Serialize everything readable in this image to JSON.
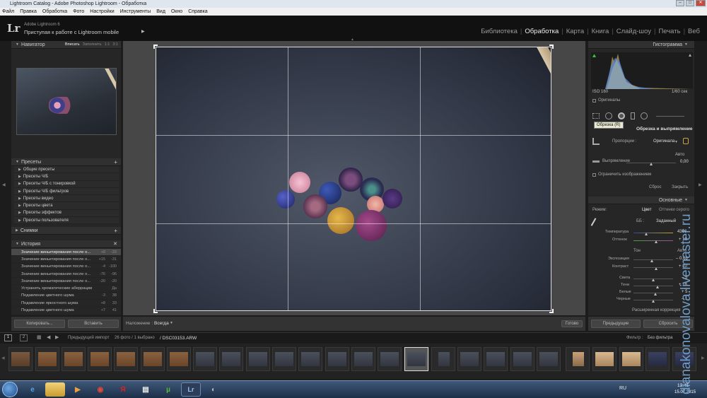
{
  "window": {
    "title": "Lightroom Catalog - Adobe Photoshop Lightroom - Обработка"
  },
  "menu": [
    "Файл",
    "Правка",
    "Обработка",
    "Фото",
    "Настройки",
    "Инструменты",
    "Вид",
    "Окно",
    "Справка"
  ],
  "identity": {
    "logo": "Lr",
    "version": "Adobe Lightroom 6",
    "subtitle": "Приступая к работе с Lightroom mobile"
  },
  "modules": [
    "Библиотека",
    "Обработка",
    "Карта",
    "Книга",
    "Слайд-шоу",
    "Печать",
    "Веб"
  ],
  "active_module": "Обработка",
  "navigator": {
    "title": "Навигатор",
    "modes": [
      "Вписать",
      "Заполнить",
      "1:1",
      "3:1"
    ]
  },
  "presets": {
    "title": "Пресеты",
    "items": [
      "Общие пресеты",
      "Пресеты Ч/Б",
      "Пресеты Ч/Б с тонировкой",
      "Пресеты Ч/Б фильтров",
      "Пресеты видео",
      "Пресеты цвета",
      "Пресеты эффектов",
      "Пресеты пользователя"
    ]
  },
  "snapshots": {
    "title": "Снимки"
  },
  "history": {
    "title": "История",
    "items": [
      {
        "label": "Значение виньетирования после о...",
        "v1": "+8",
        "v2": "-33"
      },
      {
        "label": "Значение виньетирования после о...",
        "v1": "+15",
        "v2": "-31"
      },
      {
        "label": "Значение виньетирования после о...",
        "v1": "-4",
        "v2": "-100"
      },
      {
        "label": "Значение виньетирования после о...",
        "v1": "-76",
        "v2": "-96"
      },
      {
        "label": "Значение виньетирования после о...",
        "v1": "-20",
        "v2": "-20"
      },
      {
        "label": "Устранить хроматические аберрации",
        "v1": "",
        "v2": "Да"
      },
      {
        "label": "Подавление цветного шума",
        "v1": "-3",
        "v2": "38"
      },
      {
        "label": "Подавление яркостного шума",
        "v1": "+8",
        "v2": "33"
      },
      {
        "label": "Подавление цветного шума",
        "v1": "+7",
        "v2": "41"
      }
    ]
  },
  "left_buttons": {
    "copy": "Копировать...",
    "paste": "Вставить"
  },
  "toolbar": {
    "overlay_label": "Наложение :",
    "overlay_value": "Всегда",
    "done": "Готово"
  },
  "histogram": {
    "title": "Гистограмма",
    "iso": "ISO 160",
    "shutter": "1/60 сек",
    "originals": "Оригиналы"
  },
  "tool_tooltip": "Обрезка (R)",
  "crop": {
    "title": "Обрезка и выпрямление",
    "aspect_label": "Пропорции :",
    "aspect_value": "Оригинала",
    "auto": "Авто",
    "straighten_label": "Выпрямление",
    "straighten_value": "0,00",
    "constrain": "Ограничить изображением",
    "reset": "Сброс",
    "close": "Закрыть"
  },
  "basic": {
    "title": "Основные",
    "mode_label": "Режим:",
    "mode_color": "Цвет",
    "mode_bw": "Оттенки серого",
    "wb_label": "ББ :",
    "wb_value": "Заданный",
    "sliders": [
      {
        "label": "Температура",
        "value": "4366"
      },
      {
        "label": "Оттенок",
        "value": "+ 10"
      },
      {
        "label": "Экспозиция",
        "value": "– 0,66"
      },
      {
        "label": "Контраст",
        "value": "+ 10"
      },
      {
        "label": "Света",
        "value": "– 5"
      },
      {
        "label": "Тени",
        "value": "+ 18"
      },
      {
        "label": "Белые",
        "value": "+ 5"
      },
      {
        "label": "Черные",
        "value": "– 1"
      }
    ],
    "tone_label": "Тон",
    "tone_auto": "Авто",
    "more": "Расширенная коррекция"
  },
  "right_buttons": {
    "prev": "Предыдущие",
    "reset": "Сбросить"
  },
  "filmstrip": {
    "n1": "1",
    "n2": "2",
    "source": "Предыдущий импорт",
    "count": "26 фото / 1 выбрано",
    "file": "/ DSC03153.ARW",
    "filter_label": "Фильтр :",
    "filter_value": "Без фильтра"
  },
  "taskbar": {
    "lang": "RU",
    "time": "13:45",
    "date": "15.07.2015"
  },
  "watermark": "dianakonovalova.livemaster.ru"
}
